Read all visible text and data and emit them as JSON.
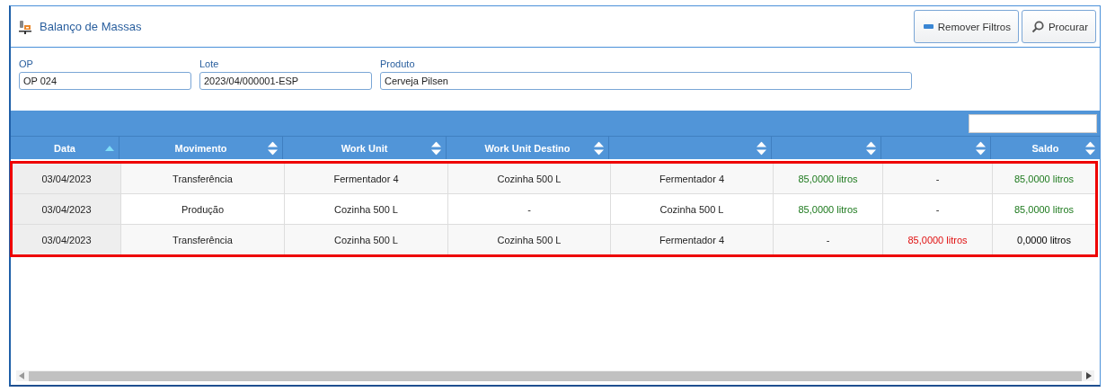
{
  "window": {
    "title": "Balanço de Massas"
  },
  "toolbar_buttons": [
    {
      "kind": "remove",
      "label": "Remover Filtros"
    },
    {
      "kind": "search",
      "label": "Procurar"
    }
  ],
  "filters": [
    {
      "label": "OP",
      "value": "OP 024"
    },
    {
      "label": "Lote",
      "value": "2023/04/000001-ESP"
    },
    {
      "label": "Produto",
      "value": "Cerveja Pilsen"
    }
  ],
  "table": {
    "columns": [
      {
        "label": "Data",
        "sorted": true
      },
      {
        "label": "Movimento",
        "sorted": false
      },
      {
        "label": "Work Unit",
        "sorted": false
      },
      {
        "label": "Work Unit Destino",
        "sorted": false
      },
      {
        "sorted": false
      },
      {
        "sorted": false
      },
      {
        "sorted": false
      },
      {
        "label": "Saldo",
        "sorted": false
      }
    ],
    "rows": [
      {
        "cells": [
          {
            "text": "03/04/2023",
            "kind": "plain"
          },
          {
            "text": "Transferência",
            "kind": "plain"
          },
          {
            "text": "Fermentador 4",
            "kind": "plain"
          },
          {
            "text": "Cozinha 500 L",
            "kind": "plain"
          },
          {
            "text": "Fermentador 4",
            "kind": "plain"
          },
          {
            "text": "85,0000 litros",
            "kind": "gain"
          },
          {
            "text": "-",
            "kind": "plain"
          },
          {
            "text": "85,0000 litros",
            "kind": "gain"
          }
        ]
      },
      {
        "cells": [
          {
            "text": "03/04/2023",
            "kind": "plain"
          },
          {
            "text": "Produção",
            "kind": "plain"
          },
          {
            "text": "Cozinha 500 L",
            "kind": "plain"
          },
          {
            "text": "-",
            "kind": "plain"
          },
          {
            "text": "Cozinha 500 L",
            "kind": "plain"
          },
          {
            "text": "85,0000 litros",
            "kind": "gain"
          },
          {
            "text": "-",
            "kind": "plain"
          },
          {
            "text": "85,0000 litros",
            "kind": "gain"
          }
        ]
      },
      {
        "cells": [
          {
            "text": "03/04/2023",
            "kind": "plain"
          },
          {
            "text": "Transferência",
            "kind": "plain"
          },
          {
            "text": "Cozinha 500 L",
            "kind": "plain"
          },
          {
            "text": "Cozinha 500 L",
            "kind": "plain"
          },
          {
            "text": "Fermentador 4",
            "kind": "plain"
          },
          {
            "text": "-",
            "kind": "plain"
          },
          {
            "text": "85,0000 litros",
            "kind": "loss"
          },
          {
            "text": "0,0000 litros",
            "kind": "total"
          }
        ]
      }
    ]
  }
}
